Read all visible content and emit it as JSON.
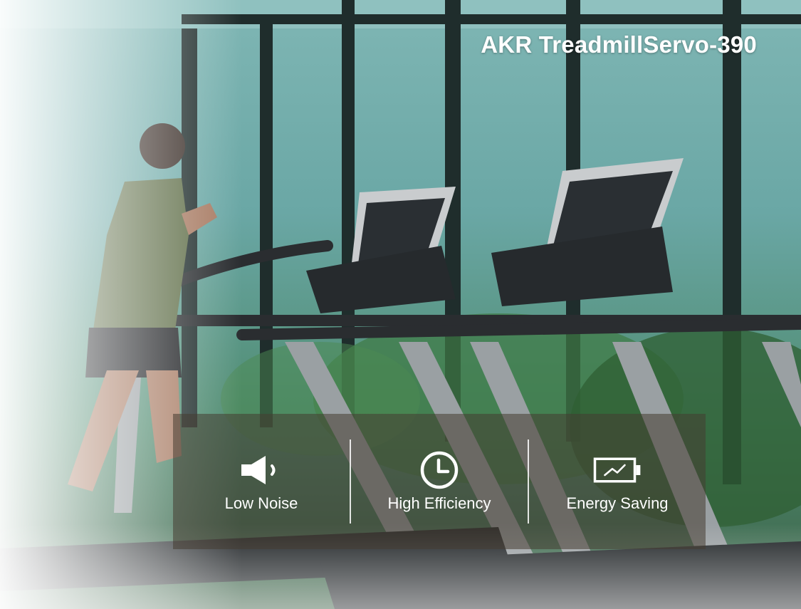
{
  "header": {
    "title": "AKR TreadmillServo-390"
  },
  "features": [
    {
      "label": "Low Noise",
      "icon": "speaker-icon"
    },
    {
      "label": "High Efficiency",
      "icon": "clock-icon"
    },
    {
      "label": "Energy Saving",
      "icon": "battery-icon"
    }
  ],
  "colors": {
    "title": "#ffffff",
    "panel": "rgba(70,60,50,0.55)",
    "text": "#ffffff"
  }
}
